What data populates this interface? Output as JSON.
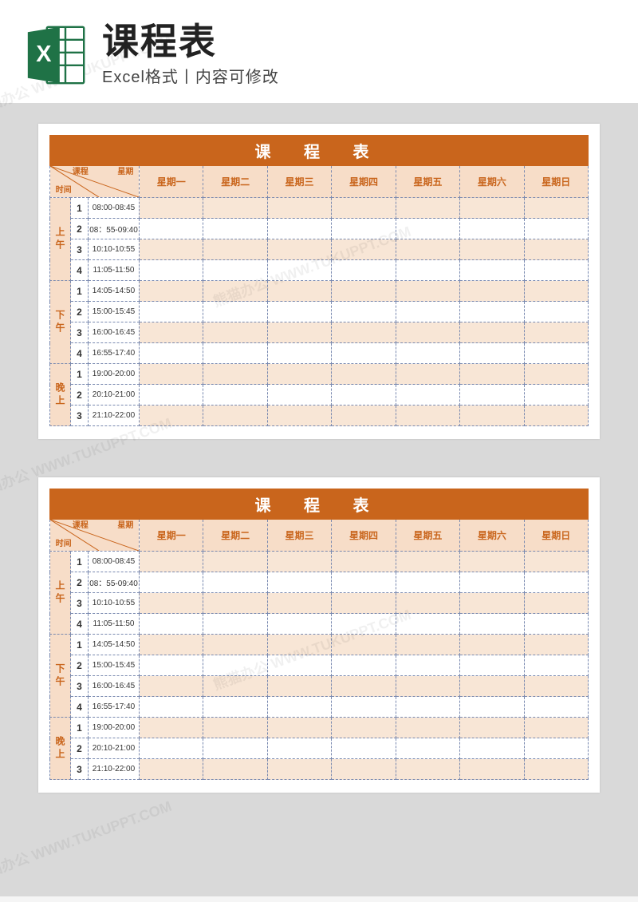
{
  "header": {
    "title": "课程表",
    "subtitle": "Excel格式丨内容可修改"
  },
  "watermark": "熊猫办公 WWW.TUKUPPT.COM",
  "table": {
    "title": "课 程 表",
    "corner": {
      "course": "课程",
      "week": "星期",
      "time": "时间"
    },
    "days": [
      "星期一",
      "星期二",
      "星期三",
      "星期四",
      "星期五",
      "星期六",
      "星期日"
    ],
    "sessions": [
      {
        "label": "上午",
        "rows": [
          {
            "num": "1",
            "time": "08:00-08:45"
          },
          {
            "num": "2",
            "time": "08：55-09:40"
          },
          {
            "num": "3",
            "time": "10:10-10:55"
          },
          {
            "num": "4",
            "time": "11:05-11:50"
          }
        ]
      },
      {
        "label": "下午",
        "rows": [
          {
            "num": "1",
            "time": "14:05-14:50"
          },
          {
            "num": "2",
            "time": "15:00-15:45"
          },
          {
            "num": "3",
            "time": "16:00-16:45"
          },
          {
            "num": "4",
            "time": "16:55-17:40"
          }
        ]
      },
      {
        "label": "晚上",
        "rows": [
          {
            "num": "1",
            "time": "19:00-20:00"
          },
          {
            "num": "2",
            "time": "20:10-21:00"
          },
          {
            "num": "3",
            "time": "21:10-22:00"
          }
        ]
      }
    ]
  }
}
